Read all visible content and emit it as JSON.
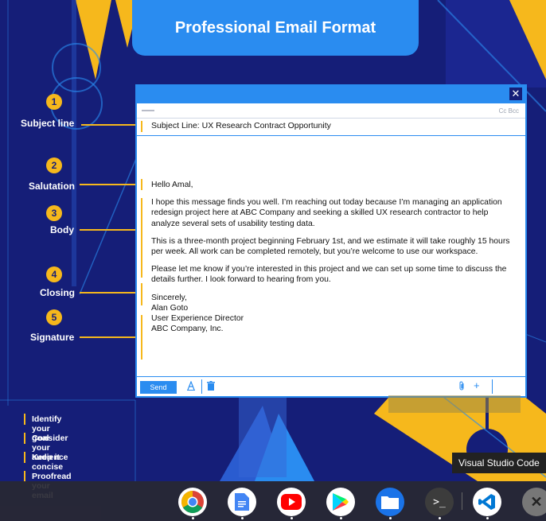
{
  "title": "Professional Email Format",
  "sections": [
    {
      "num": "1",
      "label": "Subject line"
    },
    {
      "num": "2",
      "label": "Salutation"
    },
    {
      "num": "3",
      "label": "Body"
    },
    {
      "num": "4",
      "label": "Closing"
    },
    {
      "num": "5",
      "label": "Signature"
    }
  ],
  "email": {
    "close": "✕",
    "cc_bcc": "Cc  Bcc",
    "subject": "Subject Line: UX Research Contract Opportunity",
    "salutation": "Hello Amal,",
    "body1": "I hope this message finds you well. I’m reaching out today because I’m managing an application redesign project here at ABC Company and seeking a skilled UX research contractor to help analyze several sets of usability testing data.",
    "body2": "This is a three-month project beginning February 1st, and we estimate it will take roughly 15 hours per week. All work can be completed remotely, but you’re welcome to use our workspace.",
    "closing": "Please let me know if you’re interested in this project and we can set up some time to discuss the details further. I look forward to hearing from you.",
    "signature": [
      "Sincerely,",
      "Alan Goto",
      "User Experience Director",
      "ABC Company, Inc."
    ],
    "send_label": "Send"
  },
  "tips": [
    "Identify your goal",
    "Consider your audience",
    "Keep it concise",
    "Proofread your email"
  ],
  "tooltip": "Visual Studio Code",
  "shelf_apps": [
    "chrome-icon",
    "docs-icon",
    "youtube-icon",
    "play-store-icon",
    "files-icon",
    "terminal-icon",
    "vscode-icon",
    "tools-icon"
  ],
  "colors": {
    "background": "#151e78",
    "accent": "#2a8cf0",
    "yellow": "#f6b81c"
  }
}
